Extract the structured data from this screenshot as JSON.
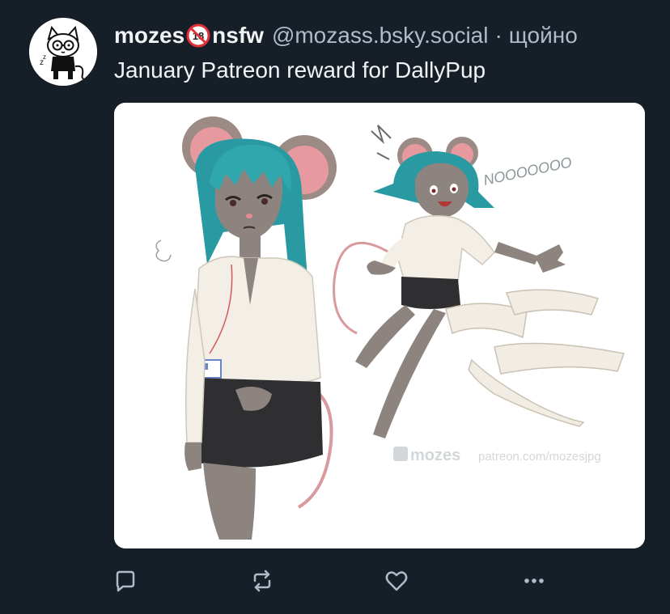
{
  "post": {
    "display_name": "mozes",
    "badge_text": "nsfw",
    "handle": "@mozass.bsky.social",
    "separator": "·",
    "timestamp": "щойно",
    "text": "January Patreon reward for DallyPup",
    "avatar_icon": "cartoon-cat-with-glasses-avatar",
    "nsfw_icon": "no-under-18-icon"
  },
  "image": {
    "sound_effect": "NOOOOOOO",
    "watermark_logo": "mozes",
    "watermark_url": "patreon.com/mozesjpg"
  },
  "actions": {
    "reply_icon": "reply-icon",
    "repost_icon": "repost-icon",
    "like_icon": "heart-icon",
    "more_icon": "ellipsis-icon"
  },
  "colors": {
    "background": "#161e27",
    "primary_text": "#f1f3f5",
    "secondary_text": "#aebbc9",
    "icon": "#aebbc9",
    "nsfw_red": "#e0303a"
  }
}
